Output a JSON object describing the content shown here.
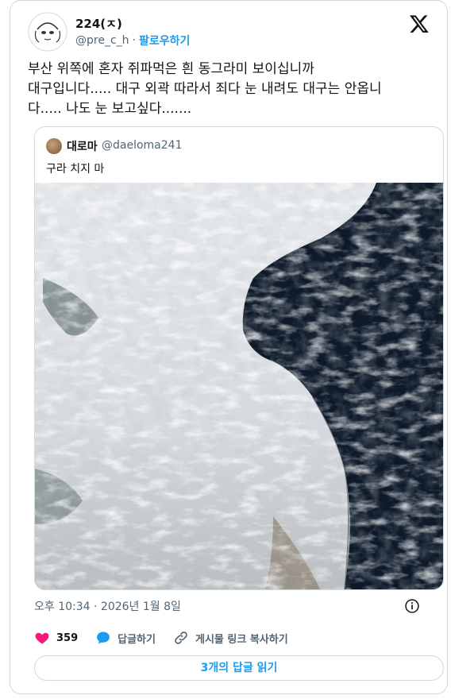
{
  "author": {
    "name": "224(ㅈ)",
    "handle": "@pre_c_h",
    "separator": "·",
    "follow_label": "팔로우하기"
  },
  "tweet": {
    "text": "부산 위쪽에 혼자 쥐파먹은 흰 동그라미 보이십니까\n대구입니다..... 대구 외곽 따라서 죄다 눈 내려도 대구는 안옵니\n다..... 나도 눈 보고싶다.......",
    "timestamp": "오후 10:34 · 2026년 1월 8일"
  },
  "quote": {
    "name": "대로마",
    "handle": "@daeloma241",
    "text": "구라 치지 마"
  },
  "actions": {
    "likes_count": "359",
    "reply_label": "답글하기",
    "copy_link_label": "게시물 링크 복사하기"
  },
  "footer": {
    "read_replies_label": "3개의 답글 읽기"
  },
  "colors": {
    "accent": "#1d9bf0",
    "like": "#f91880",
    "muted": "#536471",
    "border": "#cfd9de"
  },
  "icons": [
    "x-logo-icon",
    "info-icon",
    "heart-icon",
    "reply-bubble-icon",
    "link-icon"
  ]
}
